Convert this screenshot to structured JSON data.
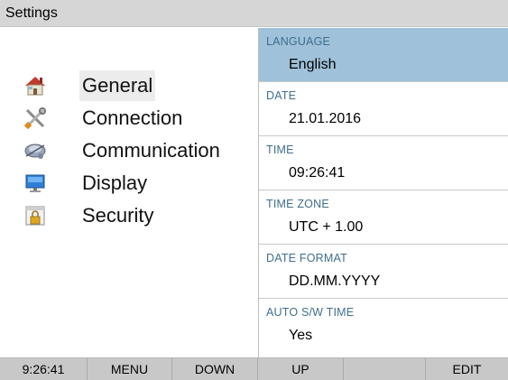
{
  "window": {
    "title": "Settings"
  },
  "menu": {
    "items": [
      {
        "label": "General",
        "icon": "house-icon",
        "selected": true
      },
      {
        "label": "Connection",
        "icon": "tools-icon",
        "selected": false
      },
      {
        "label": "Communication",
        "icon": "network-icon",
        "selected": false
      },
      {
        "label": "Display",
        "icon": "monitor-icon",
        "selected": false
      },
      {
        "label": "Security",
        "icon": "lock-icon",
        "selected": false
      }
    ]
  },
  "fields": [
    {
      "label": "LANGUAGE",
      "value": "English",
      "selected": true
    },
    {
      "label": "DATE",
      "value": "21.01.2016",
      "selected": false
    },
    {
      "label": "TIME",
      "value": "09:26:41",
      "selected": false
    },
    {
      "label": "TIME ZONE",
      "value": "UTC + 1.00",
      "selected": false
    },
    {
      "label": "DATE FORMAT",
      "value": "DD.MM.YYYY",
      "selected": false
    },
    {
      "label": "AUTO S/W TIME",
      "value": "Yes",
      "selected": false
    }
  ],
  "bottombar": {
    "clock": "9:26:41",
    "menu_label": "MENU",
    "down_label": "DOWN",
    "up_label": "UP",
    "blank_label": "",
    "edit_label": "EDIT"
  },
  "colors": {
    "selected_field_bg": "#9fc1d9",
    "field_label_color": "#3f6e8e",
    "titlebar_bg": "#d6d6d6",
    "bottombar_bg": "#c8c8c8"
  }
}
